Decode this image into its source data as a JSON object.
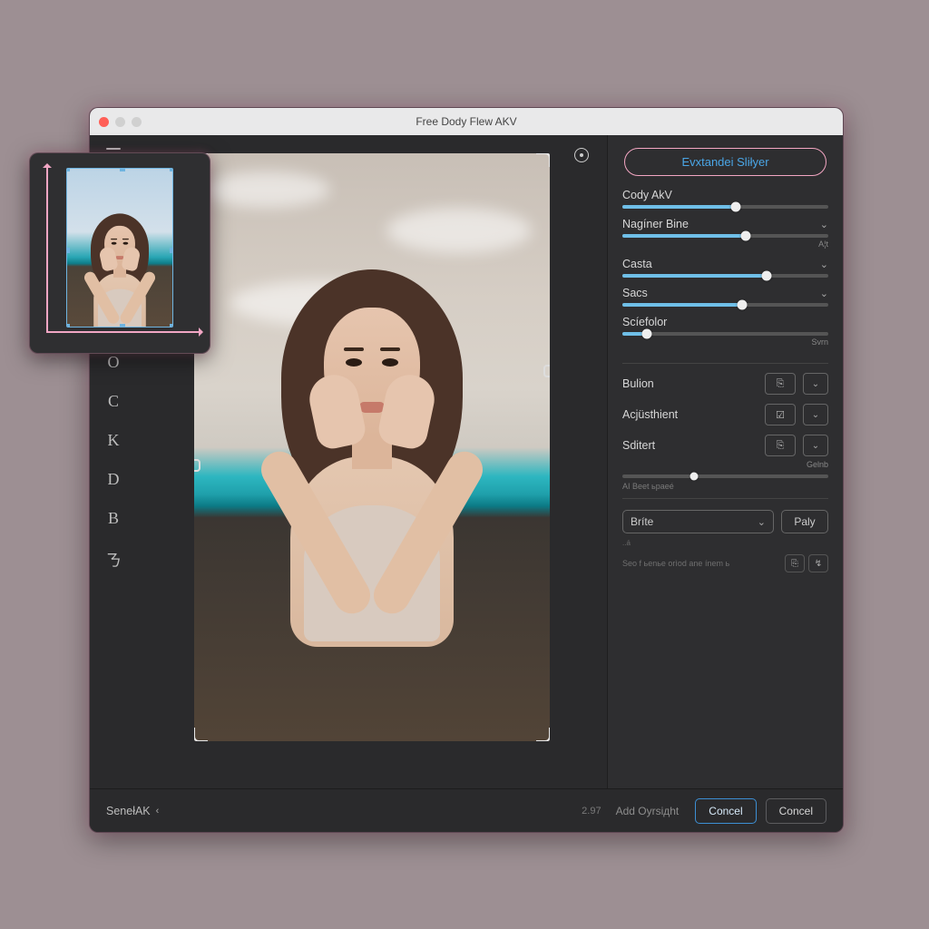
{
  "window": {
    "title": "Free Dody Flew AKV"
  },
  "tools": [
    "O",
    "C",
    "K",
    "D",
    "B",
    "ㄋ"
  ],
  "panel": {
    "top_button": "Evxtandei Sliłyer",
    "sliders": [
      {
        "label": "Cody AkV",
        "value": 55,
        "chevron": false,
        "note": ""
      },
      {
        "label": "Nagíner Bine",
        "value": 60,
        "chevron": true,
        "note": "A¦t"
      },
      {
        "label": "Casta",
        "value": 70,
        "chevron": true,
        "note": ""
      },
      {
        "label": "Sacs",
        "value": 58,
        "chevron": true,
        "note": ""
      },
      {
        "label": "Scíefolor",
        "value": 12,
        "chevron": false,
        "note": "Svrn"
      }
    ],
    "selects": [
      {
        "label": "Bulion",
        "icon": "⎘"
      },
      {
        "label": "Acjüsthient",
        "icon": "☑"
      }
    ],
    "sdtert": {
      "label": "Sditert",
      "icon": "⎘",
      "sub_label": "Gelnb",
      "sub_value": 35
    },
    "ai_note": "AI Beet ьpaeé",
    "brite": {
      "label": "Bríte",
      "play": "Paly"
    },
    "micro": "..á",
    "hint": "Seo f ьenьe orìod ane ínem ь"
  },
  "footer": {
    "left": "SenełAK",
    "num": "2.97",
    "mid": "Add Oyrsiдht",
    "primary": "Concel",
    "secondary": "Concel"
  }
}
